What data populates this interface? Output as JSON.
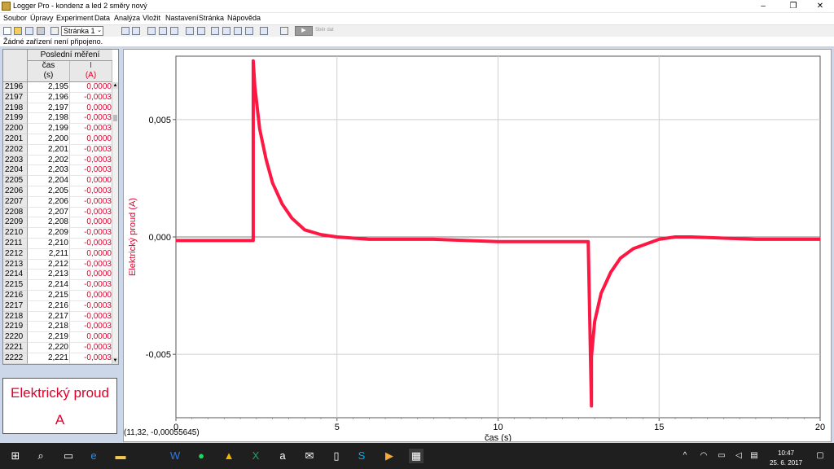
{
  "window": {
    "title": "Logger Pro - kondenz a led 2 směry nový",
    "controls": [
      "–",
      "❐",
      "✕"
    ]
  },
  "menu": [
    "Soubor",
    "Úpravy",
    "Experiment",
    "Data",
    "Analýza",
    "Vložit",
    "Nastavení",
    "Stránka",
    "Nápověda"
  ],
  "toolbar": {
    "page_select": "Stránka 1",
    "collect_label": "Sběr dat"
  },
  "status": "Žádné zařízení není připojeno.",
  "table": {
    "dataset": "Poslední měření",
    "col_time": "čas",
    "col_time_unit": "(s)",
    "col_current": "I",
    "col_current_unit": "(A)",
    "rows": [
      [
        "2196",
        "2,195",
        "0,0000"
      ],
      [
        "2197",
        "2,196",
        "-0,0003"
      ],
      [
        "2198",
        "2,197",
        "0,0000"
      ],
      [
        "2199",
        "2,198",
        "-0,0003"
      ],
      [
        "2200",
        "2,199",
        "-0,0003"
      ],
      [
        "2201",
        "2,200",
        "0,0000"
      ],
      [
        "2202",
        "2,201",
        "-0,0003"
      ],
      [
        "2203",
        "2,202",
        "-0,0003"
      ],
      [
        "2204",
        "2,203",
        "-0,0003"
      ],
      [
        "2205",
        "2,204",
        "0,0000"
      ],
      [
        "2206",
        "2,205",
        "-0,0003"
      ],
      [
        "2207",
        "2,206",
        "-0,0003"
      ],
      [
        "2208",
        "2,207",
        "-0,0003"
      ],
      [
        "2209",
        "2,208",
        "0,0000"
      ],
      [
        "2210",
        "2,209",
        "-0,0003"
      ],
      [
        "2211",
        "2,210",
        "-0,0003"
      ],
      [
        "2212",
        "2,211",
        "0,0000"
      ],
      [
        "2213",
        "2,212",
        "-0,0003"
      ],
      [
        "2214",
        "2,213",
        "0,0000"
      ],
      [
        "2215",
        "2,214",
        "-0,0003"
      ],
      [
        "2216",
        "2,215",
        "0,0000"
      ],
      [
        "2217",
        "2,216",
        "-0,0003"
      ],
      [
        "2218",
        "2,217",
        "-0,0003"
      ],
      [
        "2219",
        "2,218",
        "-0,0003"
      ],
      [
        "2220",
        "2,219",
        "0,0000"
      ],
      [
        "2221",
        "2,220",
        "-0,0003"
      ],
      [
        "2222",
        "2,221",
        "-0,0003"
      ]
    ]
  },
  "meter": {
    "name": "Elektrický proud",
    "unit": "A"
  },
  "readout": "(11,32, -0,00055645)",
  "chart_data": {
    "type": "line",
    "xlabel": "čas (s)",
    "ylabel": "Elektrický proud (A)",
    "xlim": [
      0,
      20
    ],
    "ylim": [
      -0.0077,
      0.0077
    ],
    "x_ticks": [
      0,
      5,
      10,
      15,
      20
    ],
    "x_tick_labels": [
      "0",
      "5",
      "10",
      "15",
      "20"
    ],
    "y_ticks": [
      -0.005,
      0,
      0.005
    ],
    "y_tick_labels": [
      "-0,005",
      "0,000",
      "0,005"
    ],
    "grid": true,
    "series": [
      {
        "color": "#ff1744",
        "x": [
          0,
          2.4,
          2.4,
          2.45,
          2.6,
          2.8,
          3.0,
          3.3,
          3.6,
          4.0,
          4.5,
          5.0,
          6.0,
          8.0,
          10.0,
          12.8,
          12.9,
          12.9,
          13.0,
          13.2,
          13.5,
          13.8,
          14.2,
          14.6,
          15.0,
          15.5,
          16.0,
          18.0,
          20.0
        ],
        "y": [
          -0.00015,
          -0.00015,
          0.0075,
          0.0064,
          0.0046,
          0.0033,
          0.0023,
          0.0014,
          0.0008,
          0.0003,
          0.0001,
          0.0,
          -0.0001,
          -0.0001,
          -0.0002,
          -0.0002,
          -0.0072,
          -0.0051,
          -0.0036,
          -0.0024,
          -0.0015,
          -0.0009,
          -0.0005,
          -0.0003,
          -0.0001,
          0.0,
          0.0,
          -0.0001,
          -0.0001
        ]
      }
    ]
  },
  "tray": {
    "time": "10:47",
    "date": "25. 6. 2017"
  }
}
